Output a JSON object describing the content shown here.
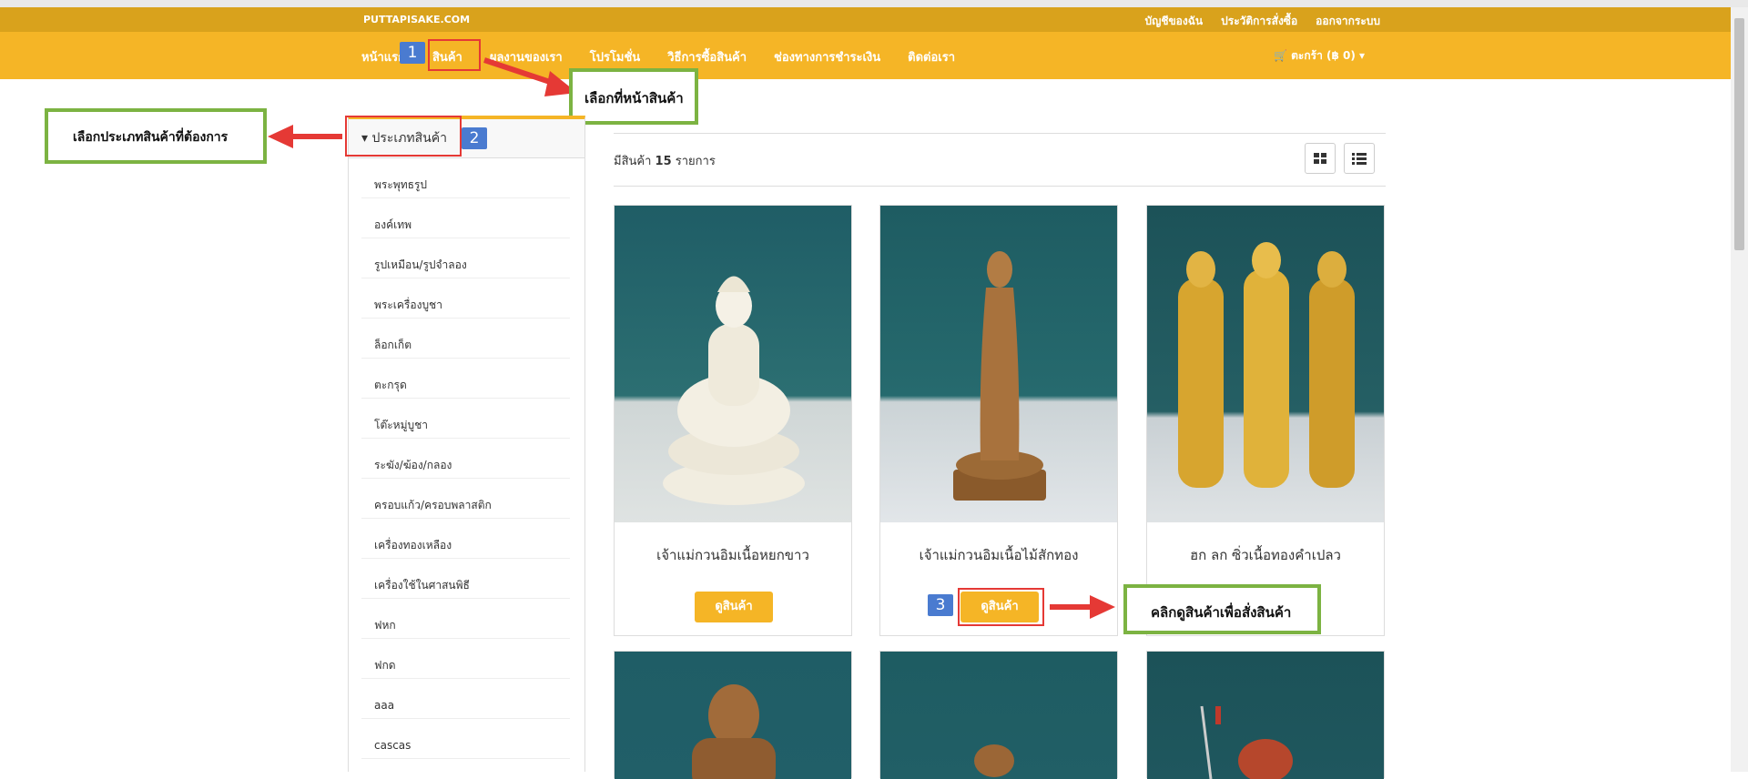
{
  "site": {
    "brand": "PUTTAPISAKE.COM"
  },
  "top_links": [
    "บัญชีของฉัน",
    "ประวัติการสั่งซื้อ",
    "ออกจากระบบ"
  ],
  "nav": {
    "items": [
      "หน้าแรก",
      "สินค้า",
      "ผลงานของเรา",
      "โปรโมชั่น",
      "วิธีการซื้อสินค้า",
      "ช่องทางการชำระเงิน",
      "ติดต่อเรา"
    ],
    "cart_label": "ตะกร้า (฿ 0) ▾"
  },
  "sidebar": {
    "title": "ประเภทสินค้า",
    "items": [
      "พระพุทธรูป",
      "องค์เทพ",
      "รูปเหมือน/รูปจำลอง",
      "พระเครื่องบูชา",
      "ล็อกเก็ต",
      "ตะกรุด",
      "โต๊ะหมู่บูชา",
      "ระฆัง/ฆ้อง/กลอง",
      "ครอบแก้ว/ครอบพลาสติก",
      "เครื่องทองเหลือง",
      "เครื่องใช้ในศาสนพิธี",
      "ฟหก",
      "ฟกด",
      "aaa",
      "cascas"
    ]
  },
  "listing": {
    "count_prefix": "มีสินค้า",
    "count": "15",
    "count_suffix": "รายการ"
  },
  "products": [
    {
      "name": "เจ้าแม่กวนอิมเนื้อหยกขาว",
      "button": "ดูสินค้า"
    },
    {
      "name": "เจ้าแม่กวนอิมเนื้อไม้สักทอง",
      "button": "ดูสินค้า"
    },
    {
      "name": "ฮก ลก ซิ่วเนื้อทองคำเปลว",
      "button": ""
    }
  ],
  "annotations": {
    "callout_product_page": "เลือกที่หน้าสินค้า",
    "callout_category": "เลือกประเภทสินค้าที่ต้องการ",
    "callout_view": "คลิกดูสินค้าเพื่อสั่งสินค้า",
    "badges": [
      "1",
      "2",
      "3"
    ]
  },
  "colors": {
    "navbar": "#f5b526",
    "topbar": "#d9a21c",
    "callout_border": "#7cb342",
    "highlight": "#e53935",
    "badge": "#4a7bd0"
  }
}
